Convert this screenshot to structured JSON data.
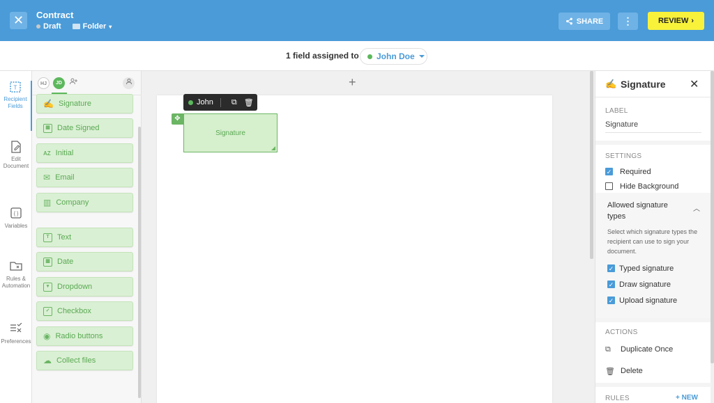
{
  "header": {
    "close_icon": "✕",
    "title": "Contract",
    "status": "Draft",
    "folder": "Folder",
    "share_label": "SHARE",
    "more_icon": "⋮",
    "review_label": "REVIEW"
  },
  "assign": {
    "text": "1 field assigned to",
    "assignee": "John Doe"
  },
  "leftnav": {
    "items": [
      {
        "label": "Recipient Fields"
      },
      {
        "label": "Edit Document"
      },
      {
        "label": "Variables"
      },
      {
        "label": "Rules & Automation"
      },
      {
        "label": "Preferences"
      }
    ]
  },
  "palette": {
    "avatars": [
      "HJ",
      "JD"
    ],
    "fields": [
      {
        "label": "Signature",
        "icon": "✍"
      },
      {
        "label": "Date Signed",
        "icon": "▦"
      },
      {
        "label": "Initial",
        "icon": "AZ"
      },
      {
        "label": "Email",
        "icon": "✉"
      },
      {
        "label": "Company",
        "icon": "▥"
      },
      {
        "label": "Text",
        "icon": "T"
      },
      {
        "label": "Date",
        "icon": "▦"
      },
      {
        "label": "Dropdown",
        "icon": "▾"
      },
      {
        "label": "Checkbox",
        "icon": "✓"
      },
      {
        "label": "Radio buttons",
        "icon": "◉"
      },
      {
        "label": "Collect files",
        "icon": "☁"
      }
    ]
  },
  "canvas": {
    "plus": "+",
    "toolbar_name": "John",
    "field_label": "Signature"
  },
  "panel": {
    "title": "Signature",
    "label_heading": "LABEL",
    "label_value": "Signature",
    "settings_heading": "SETTINGS",
    "required_label": "Required",
    "hide_bg_label": "Hide Background",
    "allowed_title": "Allowed signature types",
    "allowed_desc": "Select which signature types the recipient can use to sign your document.",
    "typed_label": "Typed signature",
    "draw_label": "Draw signature",
    "upload_label": "Upload signature",
    "actions_heading": "ACTIONS",
    "duplicate_label": "Duplicate Once",
    "delete_label": "Delete",
    "rules_heading": "RULES",
    "new_label": "+ NEW"
  },
  "colors": {
    "header_bg": "#4a9bd8",
    "review_bg": "#f9f23b",
    "field_green": "#daf0d4",
    "accent_blue": "#4a9bd8"
  }
}
